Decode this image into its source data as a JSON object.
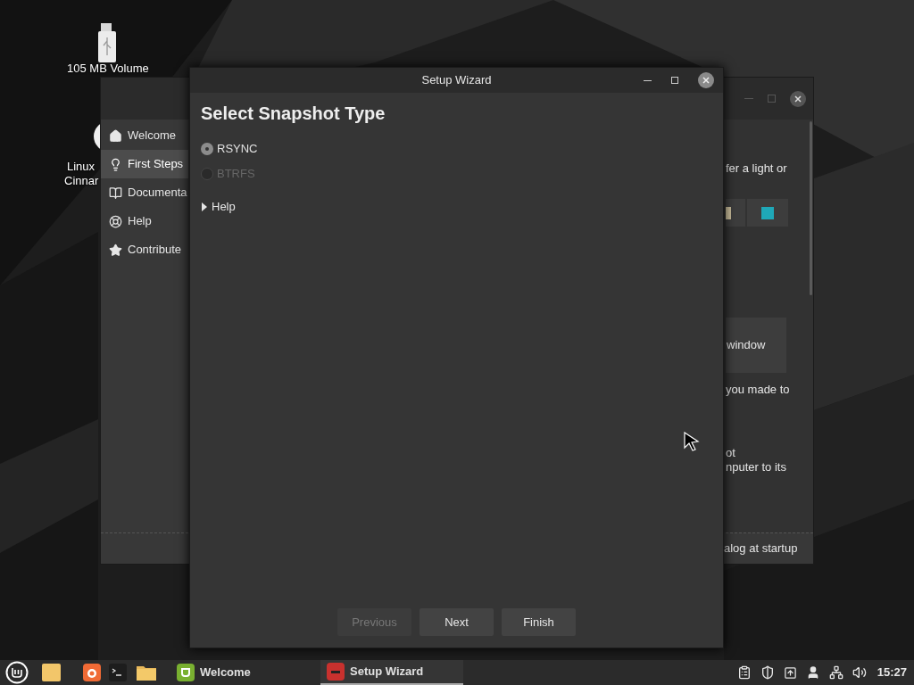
{
  "desktop_icons": [
    {
      "kind": "drive",
      "lines": [
        "105 MB Volume"
      ]
    },
    {
      "kind": "app",
      "lines": [
        "Linux",
        "Cinnar"
      ]
    }
  ],
  "welcome": {
    "sidebar": [
      {
        "label": "Welcome",
        "selected": false
      },
      {
        "label": "First Steps",
        "selected": true
      },
      {
        "label": "Documenta",
        "selected": false
      },
      {
        "label": "Help",
        "selected": false
      },
      {
        "label": "Contribute",
        "selected": false
      }
    ],
    "text_1": "fer a light or",
    "button_1": "window",
    "text_2": "you made to",
    "text_3": [
      "ot",
      "nputer to its"
    ],
    "footer": "alog at startup"
  },
  "wizard": {
    "title": "Setup Wizard",
    "heading": "Select Snapshot Type",
    "options": [
      {
        "label": "RSYNC",
        "selected": true,
        "disabled": false
      },
      {
        "label": "BTRFS",
        "selected": false,
        "disabled": true
      }
    ],
    "help": {
      "label": "Help",
      "expanded": false
    },
    "buttons": [
      {
        "label": "Previous",
        "disabled": true
      },
      {
        "label": "Next",
        "disabled": false
      },
      {
        "label": "Finish",
        "disabled": false
      }
    ]
  },
  "taskbar": {
    "windows": [
      {
        "label": "Welcome",
        "selected": false
      },
      {
        "label": "Setup Wizard",
        "selected": true
      }
    ],
    "clock": "15:27"
  }
}
